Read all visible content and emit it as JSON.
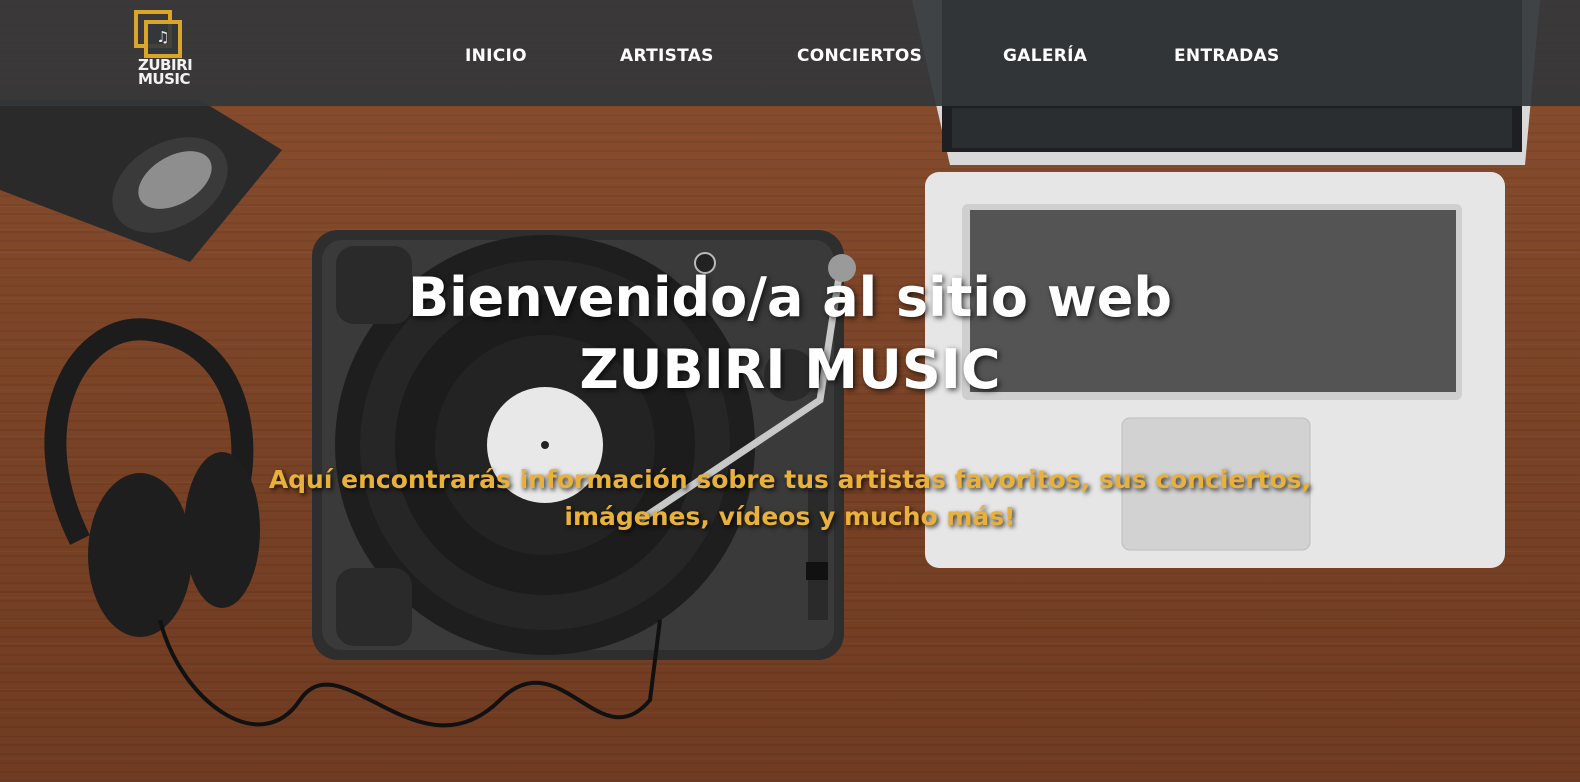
{
  "brand": {
    "logo_line1": "ZUBIRI",
    "logo_line2": "MUSIC",
    "logo_icon": "music-note-icon",
    "accent_color": "#d9a62a"
  },
  "nav": {
    "items": [
      {
        "label": "INICIO"
      },
      {
        "label": "ARTISTAS"
      },
      {
        "label": "CONCIERTOS"
      },
      {
        "label": "GALERÍA"
      },
      {
        "label": "ENTRADAS"
      }
    ]
  },
  "hero": {
    "title_line1": "Bienvenido/a al sitio web",
    "title_line2": "ZUBIRI MUSIC",
    "subtitle_line1": "Aquí encontrarás información sobre tus artistas favoritos, sus conciertos,",
    "subtitle_line2": "imágenes, vídeos y mucho más!",
    "subtitle_color": "#e8b13b"
  }
}
